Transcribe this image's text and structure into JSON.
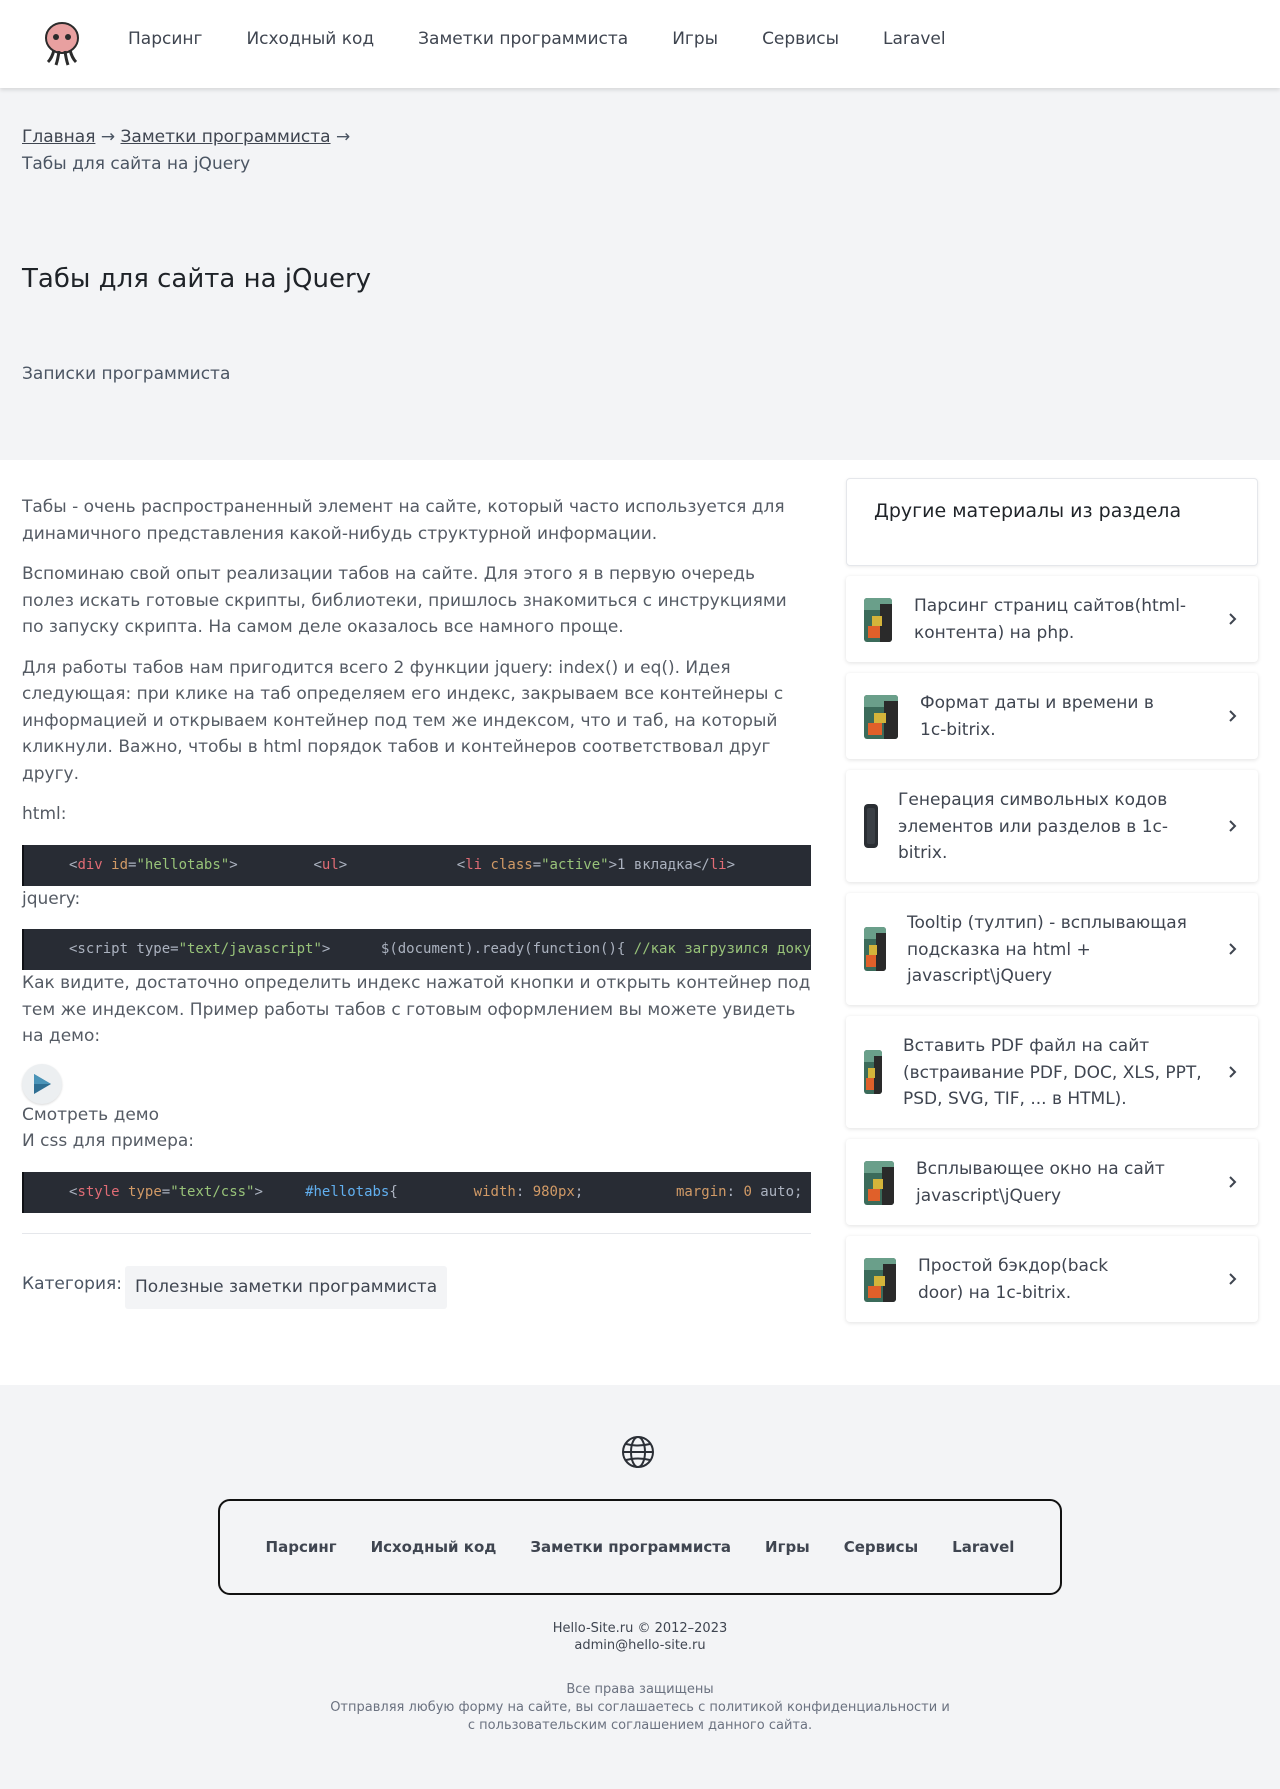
{
  "header": {
    "logo": "octopus-logo",
    "nav": [
      "Парсинг",
      "Исходный код",
      "Заметки программиста",
      "Игры",
      "Сервисы",
      "Laravel"
    ]
  },
  "breadcrumbs": {
    "home": "Главная",
    "section": "Заметки программиста",
    "arrow": "→",
    "current": "Табы для сайта на jQuery"
  },
  "page": {
    "title": "Табы для сайта на jQuery",
    "subtitle": "Записки программиста"
  },
  "article": {
    "p1": "Табы - очень распространенный элемент на сайте, который часто используется для динамичного представления какой-нибудь структурной информации.",
    "p2": "Вспоминаю свой опыт реализации табов на сайте. Для этого я в первую очередь полез искать готовые скрипты, библиотеки, пришлось знакомиться с инструкциями по запуску скрипта. На самом деле оказалось все намного проще.",
    "p3": "Для работы табов нам пригодится всего 2 функции jquery: index() и eq(). Идея следующая: при клике на таб определяем его индекс, закрываем все контейнеры с информацией и открываем контейнер под тем же индексом, что и таб, на который кликнули. Важно, чтобы в html порядок табов и контейнеров соответствовал друг другу.",
    "html_label": "html:",
    "code_html": {
      "div_tag": "div",
      "id_attr": "id",
      "id_val": "\"hellotabs\"",
      "ul_tag": "ul",
      "li_tag": "li",
      "class_attr": "class",
      "class_val": "\"active\"",
      "li_text": "1 вкладка"
    },
    "jquery_label": "jquery:",
    "code_js": {
      "script_open": "<script type=",
      "script_type": "\"text/javascript\"",
      "ready": "$(document).ready(function(){ ",
      "comment": "//как загрузился документ"
    },
    "p4": "Как видите, достаточно определить индекс нажатой кнопки и открыть контейнер под тем же индексом. Пример работы табов с готовым оформлением вы можете увидеть на демо:",
    "demo_icon": "play-icon",
    "demo_link": "Смотреть демо",
    "css_label": "И css для примера:",
    "code_css": {
      "style_tag": "style",
      "type_attr": "type",
      "type_val": "\"text/css\"",
      "selector": "#hellotabs",
      "prop1": "width",
      "val1": "980px",
      "prop2": "margin",
      "val2_num": "0",
      "val2_rest": " auto;"
    },
    "category_label": "Категория:",
    "category": "Полезные заметки программиста"
  },
  "sidebar": {
    "heading": "Другие материалы из раздела",
    "items": [
      {
        "title": "Парсинг страниц сайтов(html-контента) на php."
      },
      {
        "title": "Формат даты и времени в 1c-bitrix."
      },
      {
        "title": "Генерация символьных кодов элементов или разделов в 1c-bitrix."
      },
      {
        "title": "Tooltip (тултип) - всплывающая подсказка на html + javascript\\jQuery"
      },
      {
        "title": "Вставить PDF файл на сайт (встраивание PDF, DOC, XLS, PPT, PSD, SVG, TIF, ... в HTML)."
      },
      {
        "title": "Всплывающее окно на сайт javascript\\jQuery"
      },
      {
        "title": "Простой бэкдор(back door) на 1c-bitrix."
      }
    ]
  },
  "footer": {
    "nav": [
      "Парсинг",
      "Исходный код",
      "Заметки программиста",
      "Игры",
      "Сервисы",
      "Laravel"
    ],
    "copyright": "Hello-Site.ru © 2012–2023",
    "email": "admin@hello-site.ru",
    "rights": "Все права защищены",
    "policy1": "Отправляя любую форму на сайте, вы соглашаетесь с политикой конфиденциальности и",
    "policy2": "с пользовательским соглашением данного сайта."
  }
}
